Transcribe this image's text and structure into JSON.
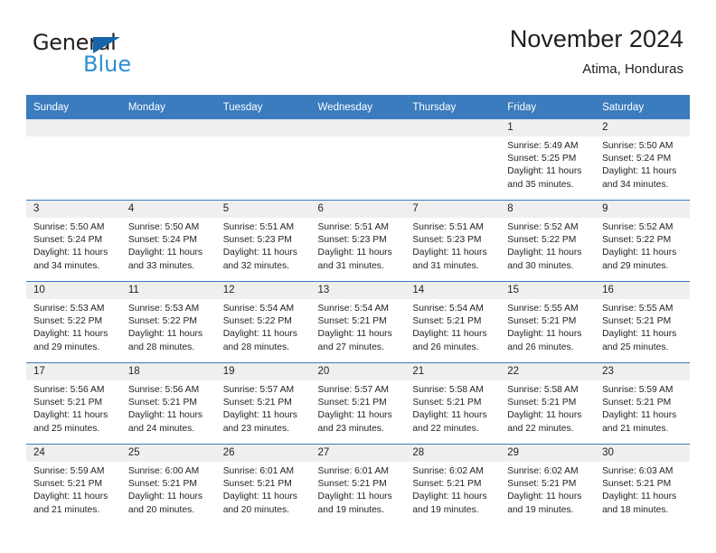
{
  "brand": {
    "word_top": "General",
    "word_bottom": "Blue",
    "triangle_color": "#1565a8",
    "blue_color": "#2e8fd4"
  },
  "header": {
    "title": "November 2024",
    "subtitle": "Atima, Honduras"
  },
  "theme": {
    "header_bg": "#3a7cbe",
    "daynum_bg": "#efefef",
    "text": "#231f20"
  },
  "weekday_headers": [
    "Sunday",
    "Monday",
    "Tuesday",
    "Wednesday",
    "Thursday",
    "Friday",
    "Saturday"
  ],
  "weeks": [
    [
      {
        "day": "",
        "empty": true
      },
      {
        "day": "",
        "empty": true
      },
      {
        "day": "",
        "empty": true
      },
      {
        "day": "",
        "empty": true
      },
      {
        "day": "",
        "empty": true
      },
      {
        "day": "1",
        "sunrise": "Sunrise: 5:49 AM",
        "sunset": "Sunset: 5:25 PM",
        "daylight": "Daylight: 11 hours and 35 minutes."
      },
      {
        "day": "2",
        "sunrise": "Sunrise: 5:50 AM",
        "sunset": "Sunset: 5:24 PM",
        "daylight": "Daylight: 11 hours and 34 minutes."
      }
    ],
    [
      {
        "day": "3",
        "sunrise": "Sunrise: 5:50 AM",
        "sunset": "Sunset: 5:24 PM",
        "daylight": "Daylight: 11 hours and 34 minutes."
      },
      {
        "day": "4",
        "sunrise": "Sunrise: 5:50 AM",
        "sunset": "Sunset: 5:24 PM",
        "daylight": "Daylight: 11 hours and 33 minutes."
      },
      {
        "day": "5",
        "sunrise": "Sunrise: 5:51 AM",
        "sunset": "Sunset: 5:23 PM",
        "daylight": "Daylight: 11 hours and 32 minutes."
      },
      {
        "day": "6",
        "sunrise": "Sunrise: 5:51 AM",
        "sunset": "Sunset: 5:23 PM",
        "daylight": "Daylight: 11 hours and 31 minutes."
      },
      {
        "day": "7",
        "sunrise": "Sunrise: 5:51 AM",
        "sunset": "Sunset: 5:23 PM",
        "daylight": "Daylight: 11 hours and 31 minutes."
      },
      {
        "day": "8",
        "sunrise": "Sunrise: 5:52 AM",
        "sunset": "Sunset: 5:22 PM",
        "daylight": "Daylight: 11 hours and 30 minutes."
      },
      {
        "day": "9",
        "sunrise": "Sunrise: 5:52 AM",
        "sunset": "Sunset: 5:22 PM",
        "daylight": "Daylight: 11 hours and 29 minutes."
      }
    ],
    [
      {
        "day": "10",
        "sunrise": "Sunrise: 5:53 AM",
        "sunset": "Sunset: 5:22 PM",
        "daylight": "Daylight: 11 hours and 29 minutes."
      },
      {
        "day": "11",
        "sunrise": "Sunrise: 5:53 AM",
        "sunset": "Sunset: 5:22 PM",
        "daylight": "Daylight: 11 hours and 28 minutes."
      },
      {
        "day": "12",
        "sunrise": "Sunrise: 5:54 AM",
        "sunset": "Sunset: 5:22 PM",
        "daylight": "Daylight: 11 hours and 28 minutes."
      },
      {
        "day": "13",
        "sunrise": "Sunrise: 5:54 AM",
        "sunset": "Sunset: 5:21 PM",
        "daylight": "Daylight: 11 hours and 27 minutes."
      },
      {
        "day": "14",
        "sunrise": "Sunrise: 5:54 AM",
        "sunset": "Sunset: 5:21 PM",
        "daylight": "Daylight: 11 hours and 26 minutes."
      },
      {
        "day": "15",
        "sunrise": "Sunrise: 5:55 AM",
        "sunset": "Sunset: 5:21 PM",
        "daylight": "Daylight: 11 hours and 26 minutes."
      },
      {
        "day": "16",
        "sunrise": "Sunrise: 5:55 AM",
        "sunset": "Sunset: 5:21 PM",
        "daylight": "Daylight: 11 hours and 25 minutes."
      }
    ],
    [
      {
        "day": "17",
        "sunrise": "Sunrise: 5:56 AM",
        "sunset": "Sunset: 5:21 PM",
        "daylight": "Daylight: 11 hours and 25 minutes."
      },
      {
        "day": "18",
        "sunrise": "Sunrise: 5:56 AM",
        "sunset": "Sunset: 5:21 PM",
        "daylight": "Daylight: 11 hours and 24 minutes."
      },
      {
        "day": "19",
        "sunrise": "Sunrise: 5:57 AM",
        "sunset": "Sunset: 5:21 PM",
        "daylight": "Daylight: 11 hours and 23 minutes."
      },
      {
        "day": "20",
        "sunrise": "Sunrise: 5:57 AM",
        "sunset": "Sunset: 5:21 PM",
        "daylight": "Daylight: 11 hours and 23 minutes."
      },
      {
        "day": "21",
        "sunrise": "Sunrise: 5:58 AM",
        "sunset": "Sunset: 5:21 PM",
        "daylight": "Daylight: 11 hours and 22 minutes."
      },
      {
        "day": "22",
        "sunrise": "Sunrise: 5:58 AM",
        "sunset": "Sunset: 5:21 PM",
        "daylight": "Daylight: 11 hours and 22 minutes."
      },
      {
        "day": "23",
        "sunrise": "Sunrise: 5:59 AM",
        "sunset": "Sunset: 5:21 PM",
        "daylight": "Daylight: 11 hours and 21 minutes."
      }
    ],
    [
      {
        "day": "24",
        "sunrise": "Sunrise: 5:59 AM",
        "sunset": "Sunset: 5:21 PM",
        "daylight": "Daylight: 11 hours and 21 minutes."
      },
      {
        "day": "25",
        "sunrise": "Sunrise: 6:00 AM",
        "sunset": "Sunset: 5:21 PM",
        "daylight": "Daylight: 11 hours and 20 minutes."
      },
      {
        "day": "26",
        "sunrise": "Sunrise: 6:01 AM",
        "sunset": "Sunset: 5:21 PM",
        "daylight": "Daylight: 11 hours and 20 minutes."
      },
      {
        "day": "27",
        "sunrise": "Sunrise: 6:01 AM",
        "sunset": "Sunset: 5:21 PM",
        "daylight": "Daylight: 11 hours and 19 minutes."
      },
      {
        "day": "28",
        "sunrise": "Sunrise: 6:02 AM",
        "sunset": "Sunset: 5:21 PM",
        "daylight": "Daylight: 11 hours and 19 minutes."
      },
      {
        "day": "29",
        "sunrise": "Sunrise: 6:02 AM",
        "sunset": "Sunset: 5:21 PM",
        "daylight": "Daylight: 11 hours and 19 minutes."
      },
      {
        "day": "30",
        "sunrise": "Sunrise: 6:03 AM",
        "sunset": "Sunset: 5:21 PM",
        "daylight": "Daylight: 11 hours and 18 minutes."
      }
    ]
  ]
}
